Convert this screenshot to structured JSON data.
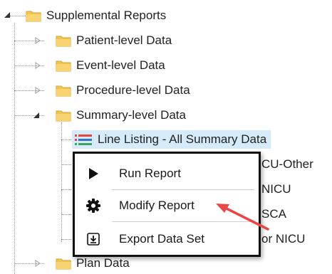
{
  "tree": {
    "root": {
      "label": "Supplemental Reports",
      "expanded": true
    },
    "children": [
      {
        "label": "Patient-level Data",
        "expanded": false
      },
      {
        "label": "Event-level Data",
        "expanded": false
      },
      {
        "label": "Procedure-level Data",
        "expanded": false
      },
      {
        "label": "Summary-level Data",
        "expanded": true
      },
      {
        "label": "Plan Data",
        "expanded": false
      }
    ],
    "summary_children": {
      "selected": "Line Listing - All Summary Data",
      "partially_visible": [
        "CU-Other",
        "NICU",
        "SCA",
        "or NICU"
      ]
    }
  },
  "context_menu": {
    "items": [
      {
        "label": "Run Report",
        "icon": "play-icon"
      },
      {
        "label": "Modify Report",
        "icon": "gear-icon"
      },
      {
        "label": "Export Data Set",
        "icon": "export-icon"
      }
    ]
  },
  "colors": {
    "folder": "#f3c350",
    "selection": "#d6ebfa",
    "arrow": "#e8474a",
    "menu_border": "#111111"
  }
}
